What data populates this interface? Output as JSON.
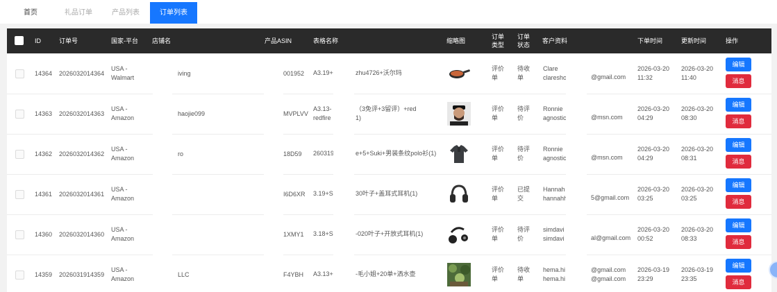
{
  "tabs": [
    {
      "label": "首页",
      "state": "normal"
    },
    {
      "label": "礼品订单",
      "state": "muted"
    },
    {
      "label": "产品列表",
      "state": "muted"
    },
    {
      "label": "订单列表",
      "state": "active"
    }
  ],
  "table": {
    "headers": {
      "id": "ID",
      "order_no": "订单号",
      "country": "国家-平台",
      "store": "店铺名",
      "asin": "产品ASIN",
      "form_name": "表格名称",
      "thumb": "缩略图",
      "order_type": "订单\n类型",
      "order_status": "订单\n状态",
      "customer": "客户资料",
      "created": "下单时间",
      "updated": "更新时间",
      "actions": "操作"
    },
    "edit_label": "编辑",
    "msg_label": "消息",
    "rows": [
      {
        "id": "14364",
        "order_no": "2026032014364",
        "country": "USA -\nWalmart",
        "store": "iving",
        "asin": "001952",
        "form_a": "A3.19+",
        "form_b": "zhu4726+沃尔玛",
        "type": "评价\n单",
        "status": "待收\n单",
        "cust_name": "Clare\nclaresho",
        "email": "@gmail.com",
        "created": "2026-03-20\n11:32",
        "updated": "2026-03-20\n11:40",
        "thumb": "pan-icon"
      },
      {
        "id": "14363",
        "order_no": "2026032014363",
        "country": "USA -\nAmazon",
        "store": "haojie099",
        "asin": "MVPLVV",
        "form_a": "A3.13-\nredfire",
        "form_b": "（3免评+3留评）+red\n1)",
        "type": "评价\n单",
        "status": "待评\n价",
        "cust_name": "Ronnie\nagnostic",
        "email": "@msn.com",
        "created": "2026-03-20\n04:29",
        "updated": "2026-03-20\n08:30",
        "thumb": "person-icon"
      },
      {
        "id": "14362",
        "order_no": "2026032014362",
        "country": "USA -\nAmazon",
        "store": "ro",
        "asin": "18D59",
        "form_a": "260319",
        "form_b": "e+5+Suki+男装条纹polo衫(1)",
        "type": "评价\n单",
        "status": "待评\n价",
        "cust_name": "Ronnie\nagnostic",
        "email": "@msn.com",
        "created": "2026-03-20\n04:29",
        "updated": "2026-03-20\n08:31",
        "thumb": "shirt-icon"
      },
      {
        "id": "14361",
        "order_no": "2026032014361",
        "country": "USA -\nAmazon",
        "store": "",
        "asin": "I6D6XR",
        "form_a": "3.19+S",
        "form_b": "30叶子+盖耳式耳机(1)",
        "type": "评价\n单",
        "status": "已提\n交",
        "cust_name": "Hannah\nhannahh",
        "email": "5@gmail.com",
        "created": "2026-03-20\n03:25",
        "updated": "2026-03-20\n03:25",
        "thumb": "headphone-icon"
      },
      {
        "id": "14360",
        "order_no": "2026032014360",
        "country": "USA -\nAmazon",
        "store": "",
        "asin": "1XMY1",
        "form_a": "3.18+S",
        "form_b": "-020叶子+开放式耳机(1)",
        "type": "评价\n单",
        "status": "待评\n价",
        "cust_name": "simdavi\nsimdavi",
        "email": "al@gmail.com",
        "created": "2026-03-20\n00:52",
        "updated": "2026-03-20\n08:33",
        "thumb": "earbuds-icon"
      },
      {
        "id": "14359",
        "order_no": "2026031914359",
        "country": "USA -\nAmazon",
        "store": "LLC",
        "asin": "F4YBH",
        "form_a": "A3.13+",
        "form_b": "-毛小姐+20单+洒水壶",
        "type": "评价\n单",
        "status": "待收\n单",
        "cust_name": "hema.hi\nhema.hi",
        "email": "@gmail.com\n@gmail.com",
        "created": "2026-03-19\n23:29",
        "updated": "2026-03-19\n23:35",
        "thumb": "garden-icon"
      }
    ]
  }
}
